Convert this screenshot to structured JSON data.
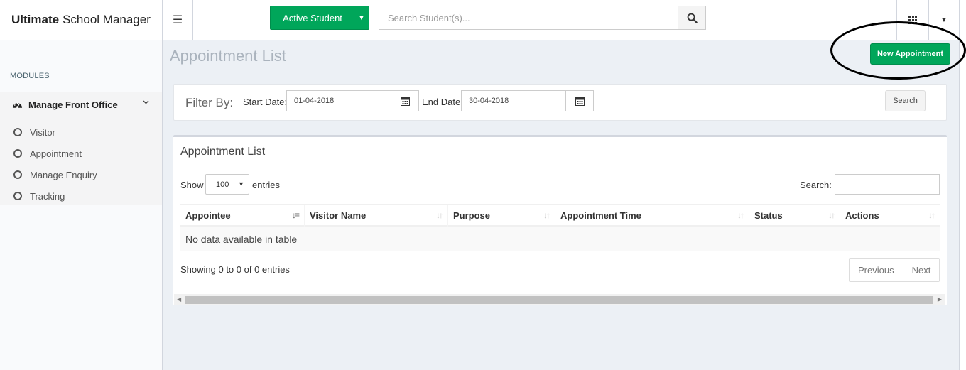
{
  "brand": {
    "bold": "Ultimate",
    "rest": "School Manager"
  },
  "topbar": {
    "active_student": "Active Student",
    "search_placeholder": "Search Student(s)..."
  },
  "sidebar": {
    "header": "MODULES",
    "group": "Manage Front Office",
    "items": [
      {
        "label": "Visitor"
      },
      {
        "label": "Appointment"
      },
      {
        "label": "Manage Enquiry"
      },
      {
        "label": "Tracking"
      }
    ]
  },
  "page": {
    "title": "Appointment List",
    "new_button": "New Appointment"
  },
  "filter": {
    "label": "Filter By:",
    "start_label": "Start Date:",
    "start_value": "01-04-2018",
    "end_label": "End Date:",
    "end_value": "30-04-2018",
    "search_button": "Search"
  },
  "list": {
    "title": "Appointment List",
    "show_label": "Show",
    "show_value": "100",
    "entries_label": "entries",
    "search_label": "Search:",
    "columns": [
      "Appointee",
      "Visitor Name",
      "Purpose",
      "Appointment Time",
      "Status",
      "Actions"
    ],
    "empty_text": "No data available in table",
    "info": "Showing 0 to 0 of 0 entries",
    "prev": "Previous",
    "next": "Next"
  },
  "colors": {
    "accent_green": "#00a65a",
    "background": "#ecf0f5"
  }
}
